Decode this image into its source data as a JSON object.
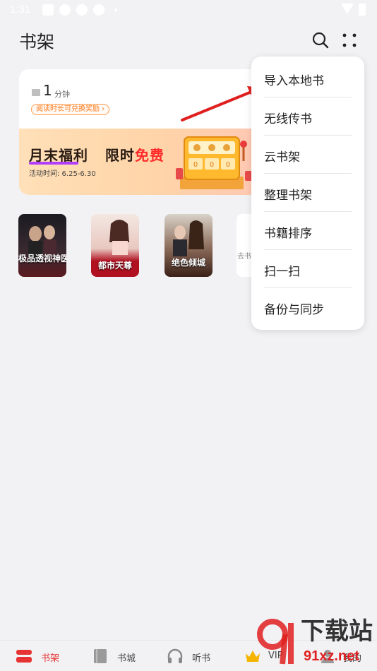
{
  "status_bar": {
    "time": "1:31"
  },
  "header": {
    "title": "书架",
    "search_icon": "search-icon",
    "more_icon": "more-grid-icon"
  },
  "reading_card": {
    "minutes_value": "1",
    "minutes_unit": "分钟",
    "reward_link": "阅读时长可兑换奖励 ›",
    "promo": {
      "title_part1": "月末福利",
      "title_part2": "限时",
      "title_free": "免费",
      "date": "活动时间: 6.25-6.30"
    }
  },
  "books": [
    {
      "cover_title": "极品透视神医",
      "colors": [
        "#1b1b22",
        "#3a2a30"
      ]
    },
    {
      "cover_title": "都市天尊",
      "colors": [
        "#f4e7e2",
        "#b01020"
      ]
    },
    {
      "cover_title": "绝色倾城",
      "colors": [
        "#d9d2c8",
        "#3a2018"
      ]
    }
  ],
  "go_card": {
    "label": "去书"
  },
  "menu": {
    "items": [
      {
        "label": "导入本地书"
      },
      {
        "label": "无线传书"
      },
      {
        "label": "云书架"
      },
      {
        "label": "整理书架"
      },
      {
        "label": "书籍排序"
      },
      {
        "label": "扫一扫"
      },
      {
        "label": "备份与同步"
      }
    ]
  },
  "tab_bar": {
    "tabs": [
      {
        "label": "书架",
        "icon": "bookshelf-icon",
        "active": true
      },
      {
        "label": "书城",
        "icon": "book-icon",
        "active": false
      },
      {
        "label": "听书",
        "icon": "headphones-icon",
        "active": false
      },
      {
        "label": "VIP",
        "icon": "crown-icon",
        "active": false
      },
      {
        "label": "我的",
        "icon": "profile-icon",
        "active": false
      }
    ]
  },
  "watermark": {
    "brand": "下载站",
    "domain": "91xz.net"
  },
  "colors": {
    "accent": "#e63232",
    "promo_free": "#ff2a2a",
    "arrow": "#e02020"
  }
}
